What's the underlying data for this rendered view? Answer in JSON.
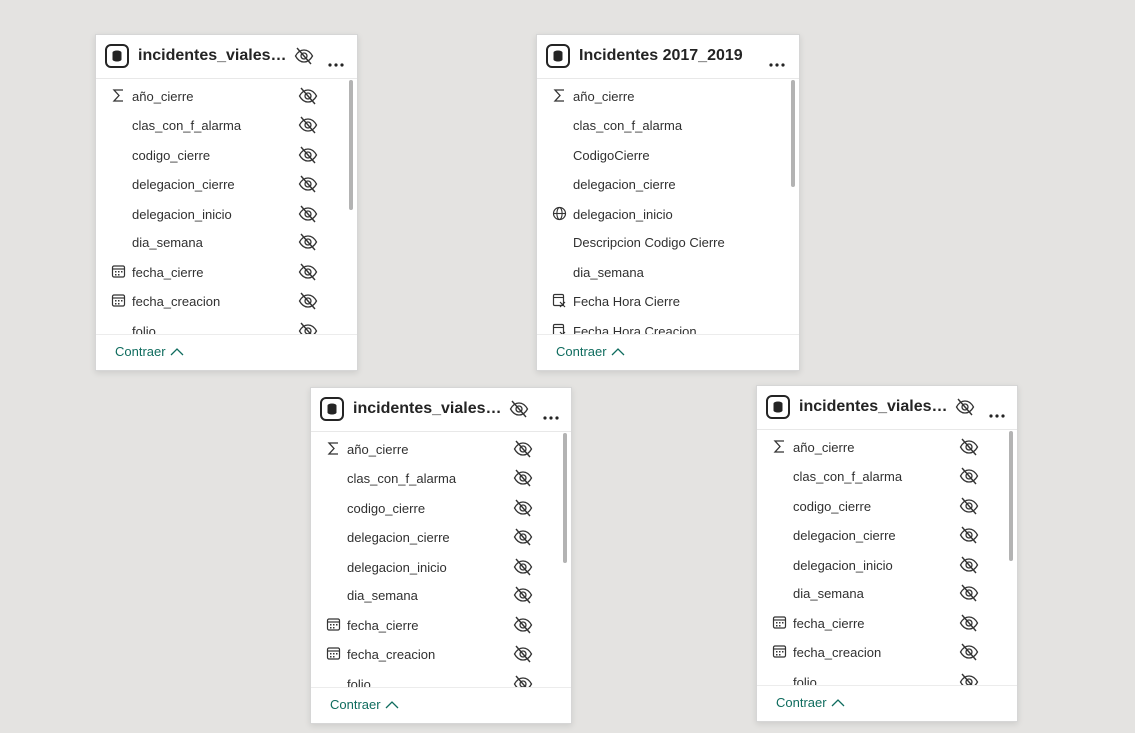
{
  "cards": [
    {
      "title": "incidentes_viales_2...",
      "collapse_label": "Contraer",
      "fields": [
        {
          "label": "año_cierre",
          "icon": "sigma-icon"
        },
        {
          "label": "clas_con_f_alarma",
          "icon": ""
        },
        {
          "label": "codigo_cierre",
          "icon": ""
        },
        {
          "label": "delegacion_cierre",
          "icon": ""
        },
        {
          "label": "delegacion_inicio",
          "icon": ""
        },
        {
          "label": "dia_semana",
          "icon": ""
        },
        {
          "label": "fecha_cierre",
          "icon": "calendar-icon"
        },
        {
          "label": "fecha_creacion",
          "icon": "calendar-icon"
        },
        {
          "label": "folio",
          "icon": ""
        }
      ]
    },
    {
      "title": "Incidentes 2017_2019",
      "collapse_label": "Contraer",
      "fields": [
        {
          "label": "año_cierre",
          "icon": "sigma-icon"
        },
        {
          "label": "clas_con_f_alarma",
          "icon": ""
        },
        {
          "label": "CodigoCierre",
          "icon": ""
        },
        {
          "label": "delegacion_cierre",
          "icon": ""
        },
        {
          "label": "delegacion_inicio",
          "icon": "globe-icon"
        },
        {
          "label": "Descripcion Codigo Cierre",
          "icon": ""
        },
        {
          "label": "dia_semana",
          "icon": ""
        },
        {
          "label": "Fecha Hora Cierre",
          "icon": "calculated-date-icon"
        },
        {
          "label": "Fecha Hora Creacion",
          "icon": "calculated-date-icon"
        }
      ]
    },
    {
      "title": "incidentes_viales_2...",
      "collapse_label": "Contraer",
      "fields": [
        {
          "label": "año_cierre",
          "icon": "sigma-icon"
        },
        {
          "label": "clas_con_f_alarma",
          "icon": ""
        },
        {
          "label": "codigo_cierre",
          "icon": ""
        },
        {
          "label": "delegacion_cierre",
          "icon": ""
        },
        {
          "label": "delegacion_inicio",
          "icon": ""
        },
        {
          "label": "dia_semana",
          "icon": ""
        },
        {
          "label": "fecha_cierre",
          "icon": "calendar-icon"
        },
        {
          "label": "fecha_creacion",
          "icon": "calendar-icon"
        },
        {
          "label": "folio",
          "icon": ""
        }
      ]
    },
    {
      "title": "incidentes_viales_2...",
      "collapse_label": "Contraer",
      "fields": [
        {
          "label": "año_cierre",
          "icon": "sigma-icon"
        },
        {
          "label": "clas_con_f_alarma",
          "icon": ""
        },
        {
          "label": "codigo_cierre",
          "icon": ""
        },
        {
          "label": "delegacion_cierre",
          "icon": ""
        },
        {
          "label": "delegacion_inicio",
          "icon": ""
        },
        {
          "label": "dia_semana",
          "icon": ""
        },
        {
          "label": "fecha_cierre",
          "icon": "calendar-icon"
        },
        {
          "label": "fecha_creacion",
          "icon": "calendar-icon"
        },
        {
          "label": "folio",
          "icon": ""
        }
      ]
    }
  ],
  "colors": {
    "canvas": "#e4e3e1",
    "link": "#0f6c5e",
    "text": "#242424"
  }
}
